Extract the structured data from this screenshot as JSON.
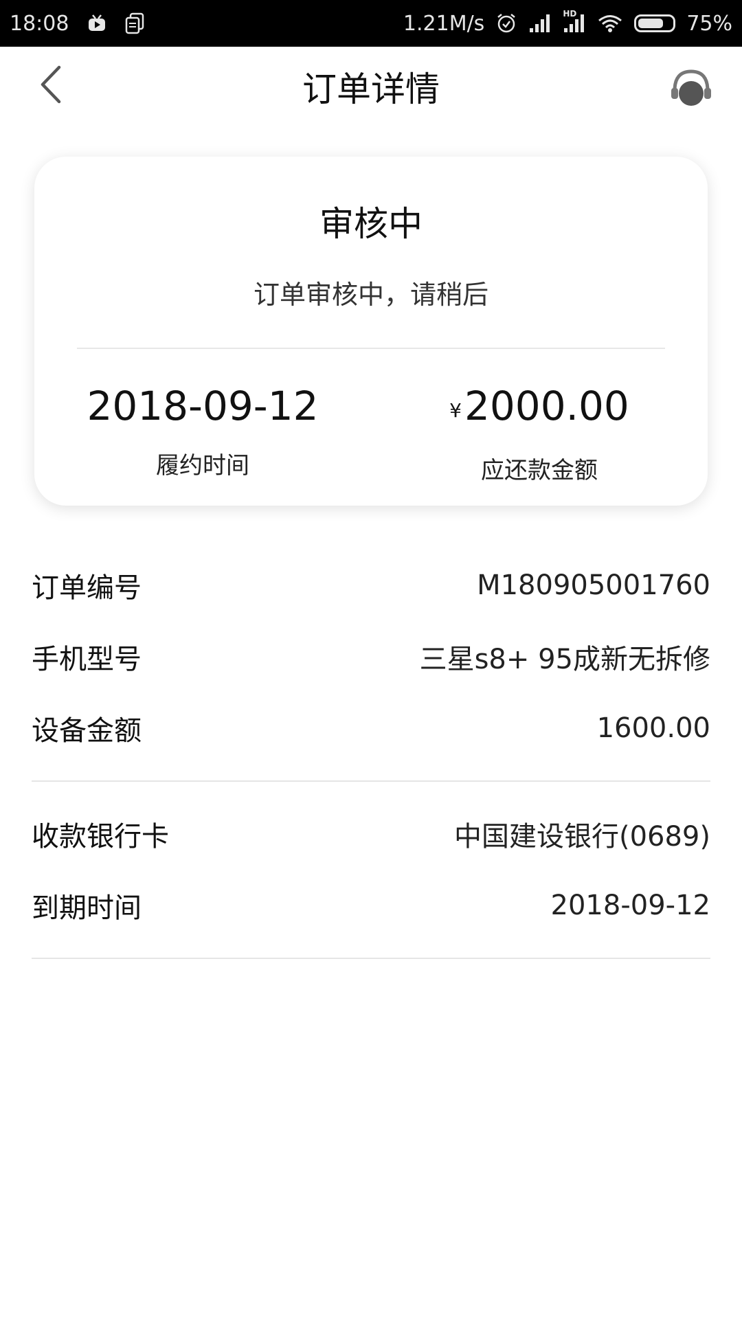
{
  "status_bar": {
    "time": "18:08",
    "network_speed": "1.21M/s",
    "network_type": "HD",
    "battery_percent": "75%",
    "battery_level": 0.75,
    "icons": [
      "tv-icon",
      "document-icon",
      "alarm-icon",
      "signal-icon",
      "hd-signal-icon",
      "wifi-icon",
      "battery-icon"
    ]
  },
  "nav": {
    "title": "订单详情",
    "back_icon": "chevron-left-icon",
    "service_icon": "headset-icon"
  },
  "status_card": {
    "title": "审核中",
    "subtitle": "订单审核中，请稍后",
    "fulfillment_date": "2018-09-12",
    "fulfillment_label": "履约时间",
    "currency_symbol": "¥",
    "amount": "2000.00",
    "amount_label": "应还款金额"
  },
  "details": {
    "order_no_label": "订单编号",
    "order_no": "M180905001760",
    "phone_model_label": "手机型号",
    "phone_model": "三星s8+ 95成新无拆修",
    "device_amount_label": "设备金额",
    "device_amount": "1600.00",
    "bank_card_label": "收款银行卡",
    "bank_card": "中国建设银行(0689)",
    "due_date_label": "到期时间",
    "due_date": "2018-09-12"
  }
}
